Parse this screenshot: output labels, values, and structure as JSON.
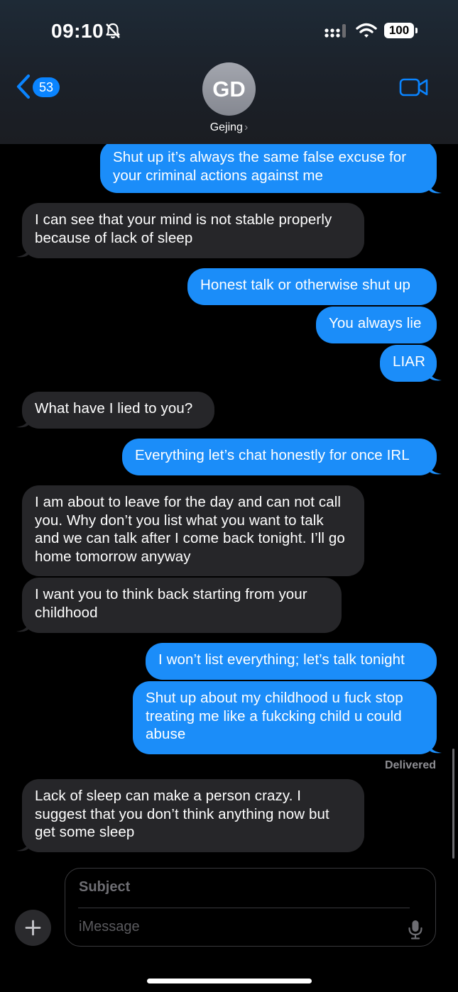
{
  "status_bar": {
    "time": "09:10",
    "battery": "100"
  },
  "header": {
    "unread_count": "53",
    "avatar_initials": "GD",
    "contact_name": "Gejing",
    "chevron": "›"
  },
  "messages": [
    {
      "direction": "sent",
      "text": "Shut up it’s always the same false excuse for your criminal actions against me"
    },
    {
      "direction": "received",
      "text": "I can see that your mind is not stable properly because of lack of sleep"
    },
    {
      "direction": "sent",
      "text": "Honest talk or otherwise shut up"
    },
    {
      "direction": "sent",
      "text": "You always lie"
    },
    {
      "direction": "sent",
      "text": "LIAR"
    },
    {
      "direction": "received",
      "text": "What have I lied to you?"
    },
    {
      "direction": "sent",
      "text": "Everything let’s chat honestly for once IRL"
    },
    {
      "direction": "received",
      "text": "I am about to leave for the day and can not call you. Why don’t you list what you want to talk and we can talk after I come back tonight. I’ll go home tomorrow anyway"
    },
    {
      "direction": "received",
      "text": "I want you to think back starting from your childhood"
    },
    {
      "direction": "sent",
      "text": "I won’t list everything; let’s talk tonight"
    },
    {
      "direction": "sent",
      "text": "Shut up about my childhood u fuck stop treating me like a fukcking child u could abuse"
    },
    {
      "direction": "received",
      "text": "Lack of sleep can make a person crazy. I suggest that you don’t think anything now but get some sleep"
    }
  ],
  "delivery_status": "Delivered",
  "compose": {
    "subject_placeholder": "Subject",
    "message_placeholder": "iMessage"
  },
  "colors": {
    "sent_bubble": "#1b8df9",
    "received_bubble": "#262629",
    "accent": "#0a84ff"
  }
}
